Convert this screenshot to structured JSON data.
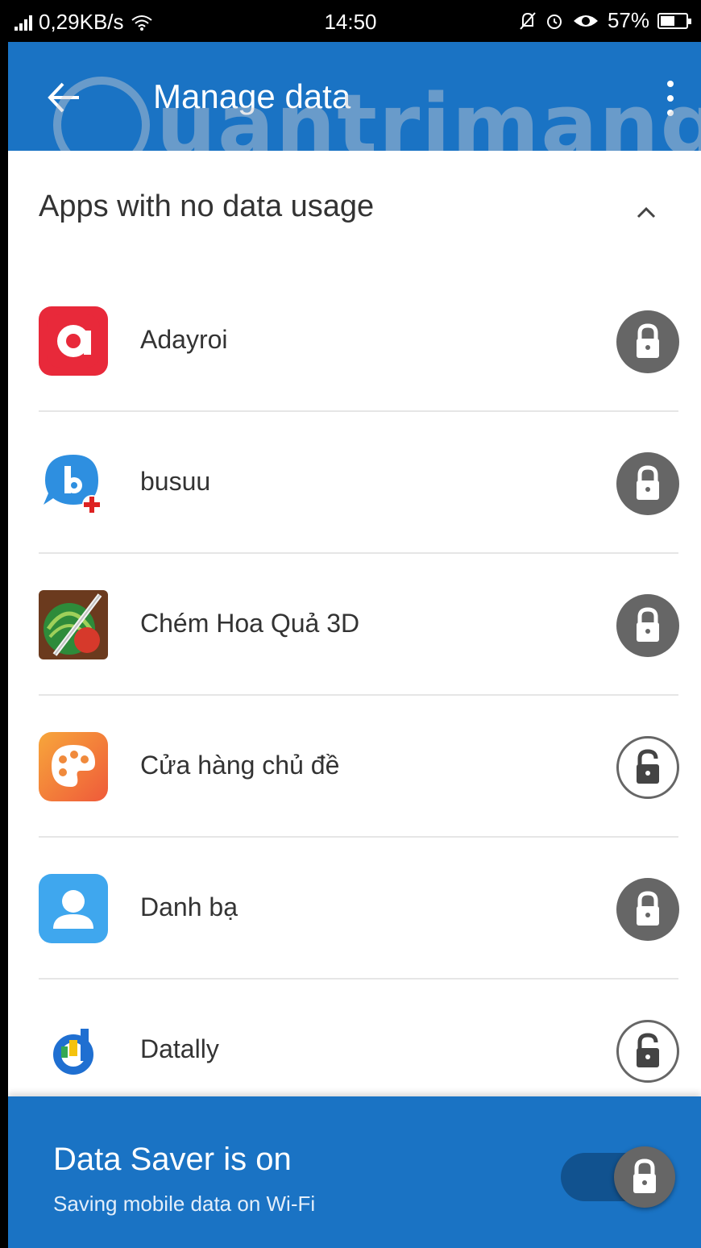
{
  "status_bar": {
    "network_speed": "0,29KB/s",
    "time": "14:50",
    "battery": "57%",
    "battery_level": 0.57
  },
  "app_bar": {
    "title": "Manage data"
  },
  "section": {
    "header": "Apps with no data usage"
  },
  "apps": [
    {
      "name": "Adayroi",
      "icon": "adayroi-app-icon",
      "locked": true
    },
    {
      "name": "busuu",
      "icon": "busuu-app-icon",
      "locked": true
    },
    {
      "name": "Chém Hoa Quả 3D",
      "icon": "fruit-ninja-app-icon",
      "locked": true
    },
    {
      "name": "Cửa hàng chủ đề",
      "icon": "theme-store-app-icon",
      "locked": false
    },
    {
      "name": "Danh bạ",
      "icon": "contacts-app-icon",
      "locked": true
    },
    {
      "name": "Datally",
      "icon": "datally-app-icon",
      "locked": false
    }
  ],
  "banner": {
    "title": "Data Saver is on",
    "subtitle": "Saving mobile data on Wi-Fi",
    "toggle_on": true
  },
  "watermark": {
    "text": "uantrimang"
  },
  "colors": {
    "primary": "#1a73c4",
    "lock_on": "#666666",
    "text": "#333333"
  }
}
